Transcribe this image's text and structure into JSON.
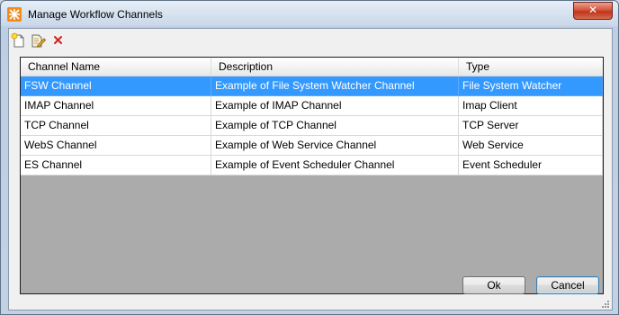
{
  "window": {
    "title": "Manage Workflow Channels",
    "close_label": "✕"
  },
  "toolbar": {
    "buttons": [
      {
        "name": "new-channel",
        "icon": "new-document-icon"
      },
      {
        "name": "edit-channel",
        "icon": "edit-document-icon"
      },
      {
        "name": "delete-channel",
        "icon": "delete-x-icon"
      }
    ]
  },
  "grid": {
    "columns": [
      "Channel Name",
      "Description",
      "Type"
    ],
    "rows": [
      {
        "name": "FSW Channel",
        "description": "Example of File System Watcher Channel",
        "type": "File System Watcher",
        "selected": true
      },
      {
        "name": "IMAP Channel",
        "description": "Example of IMAP Channel",
        "type": "Imap Client",
        "selected": false
      },
      {
        "name": "TCP Channel",
        "description": "Example of TCP Channel",
        "type": "TCP Server",
        "selected": false
      },
      {
        "name": "WebS Channel",
        "description": "Example of Web Service Channel",
        "type": "Web Service",
        "selected": false
      },
      {
        "name": "ES Channel",
        "description": "Example of Event Scheduler Channel",
        "type": "Event Scheduler",
        "selected": false
      }
    ]
  },
  "footer": {
    "ok_label": "Ok",
    "cancel_label": "Cancel"
  },
  "colors": {
    "selection": "#3399ff",
    "grid_empty": "#ababab",
    "delete_icon": "#d42020",
    "app_icon": "#f18b1d"
  }
}
